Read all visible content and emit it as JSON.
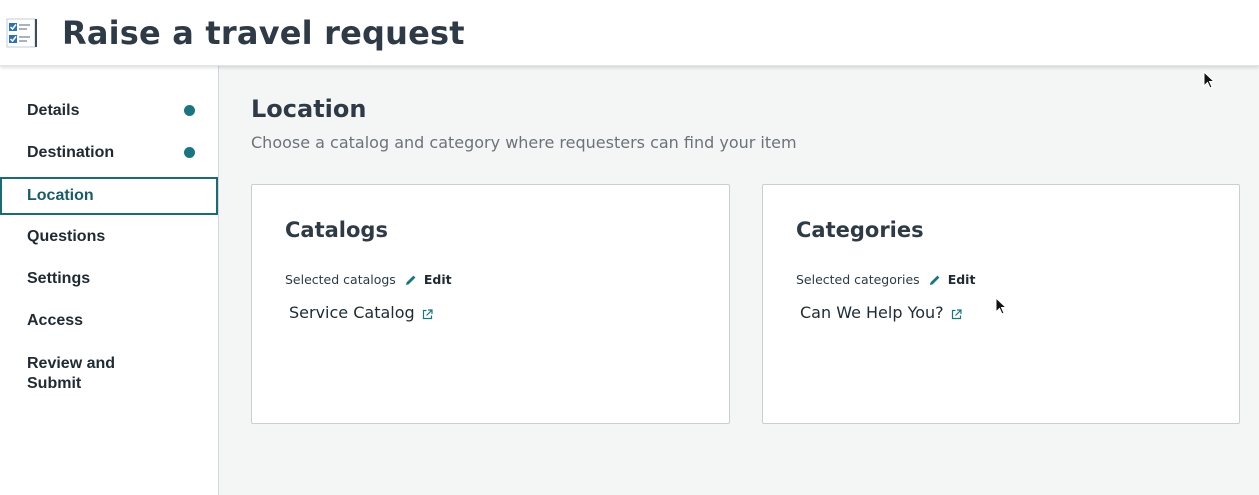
{
  "header": {
    "title": "Raise a travel request",
    "icon": "checklist-icon"
  },
  "sidebar": {
    "items": [
      {
        "label": "Details",
        "status": "complete"
      },
      {
        "label": "Destination",
        "status": "complete"
      },
      {
        "label": "Location",
        "status": "active"
      },
      {
        "label": "Questions",
        "status": ""
      },
      {
        "label": "Settings",
        "status": ""
      },
      {
        "label": "Access",
        "status": ""
      },
      {
        "label": "Review and Submit",
        "status": ""
      }
    ]
  },
  "main": {
    "title": "Location",
    "subtitle": "Choose a catalog and category where requesters can find your item",
    "cards": [
      {
        "title": "Catalogs",
        "selected_label": "Selected catalogs",
        "edit_label": "Edit",
        "item": "Service Catalog"
      },
      {
        "title": "Categories",
        "selected_label": "Selected categories",
        "edit_label": "Edit",
        "item": "Can We Help You?"
      }
    ]
  },
  "colors": {
    "accent": "#1a7583",
    "text": "#2e3a46",
    "muted": "#6b737a",
    "main_bg": "#f4f5f5"
  }
}
